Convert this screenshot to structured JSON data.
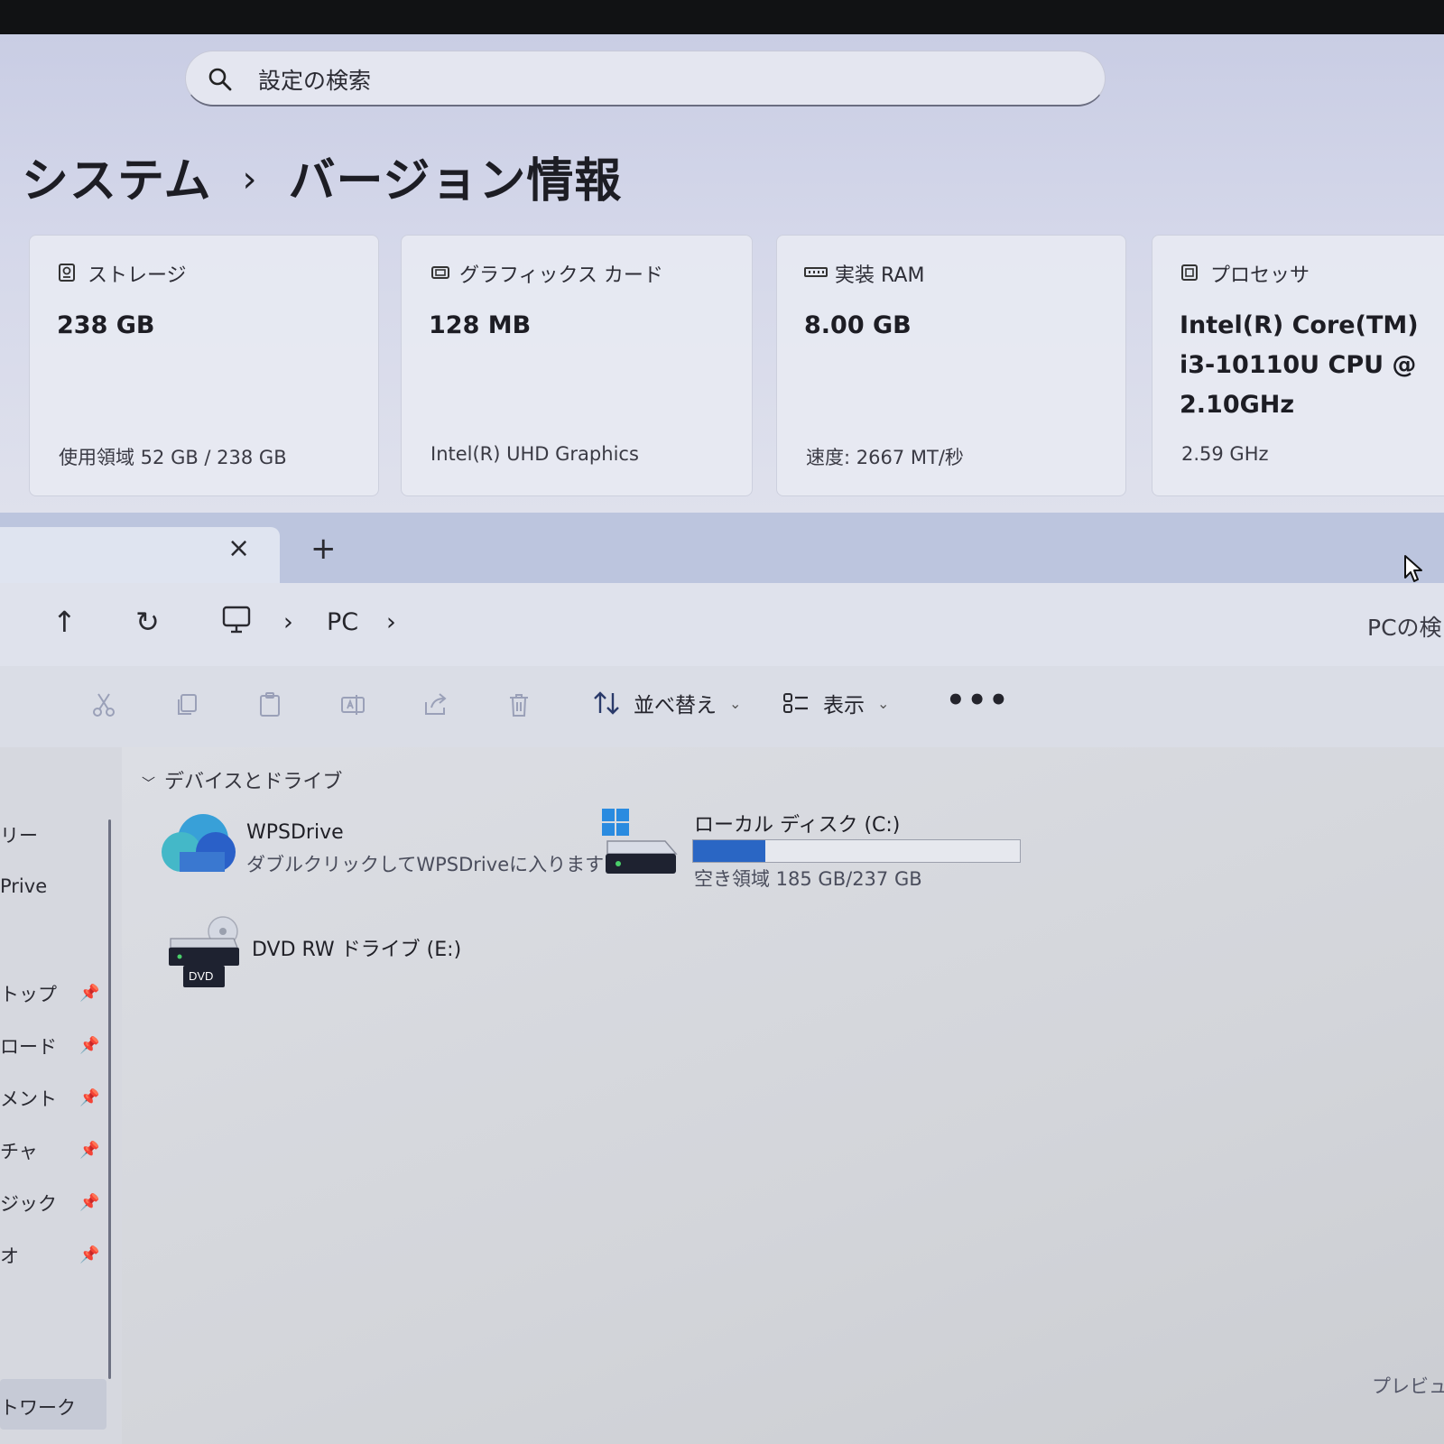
{
  "settings": {
    "search_placeholder": "設定の検索",
    "breadcrumb_root": "システム",
    "breadcrumb_separator": "›",
    "page_title": "バージョン情報",
    "cards": [
      {
        "label": "ストレージ",
        "value": "238 GB",
        "detail": "使用領域 52 GB / 238 GB",
        "icon": "storage-icon"
      },
      {
        "label": "グラフィックス カード",
        "value": "128 MB",
        "detail": "Intel(R) UHD Graphics",
        "icon": "gpu-icon"
      },
      {
        "label": "実装 RAM",
        "value": "8.00 GB",
        "detail": "速度: 2667 MT/秒",
        "icon": "ram-icon"
      },
      {
        "label": "プロセッサ",
        "value_lines": [
          "Intel(R) Core(TM)",
          "i3-10110U CPU @",
          "2.10GHz"
        ],
        "detail": "2.59 GHz",
        "icon": "cpu-icon"
      }
    ]
  },
  "explorer": {
    "tab": {
      "close_label": "×"
    },
    "new_tab_label": "+",
    "address": {
      "up_label": "↑",
      "refresh_label": "↻",
      "crumb_sep": "›",
      "location": "PC",
      "search_placeholder": "PCの検"
    },
    "toolbar": {
      "sort_label": "並べ替え",
      "view_label": "表示",
      "more_label": "•••",
      "caret": "⌄"
    },
    "nav_items": [
      "リー",
      "Prive",
      "トップ",
      "ロード",
      "メント",
      "チャ",
      "ジック",
      "オ",
      "トワーク"
    ],
    "group_header": "デバイスとドライブ",
    "drives": {
      "wps": {
        "name": "WPSDrive",
        "desc": "ダブルクリックしてWPSDriveに入ります"
      },
      "local": {
        "name": "ローカル ディスク (C:)",
        "free": "空き領域 185 GB/237 GB",
        "used_fraction": 0.22
      },
      "dvd": {
        "name": "DVD RW ドライブ (E:)",
        "badge": "DVD"
      }
    },
    "preview_label": "プレビュ"
  },
  "colors": {
    "accent": "#2a66c4",
    "dark_bar": "#111214"
  }
}
